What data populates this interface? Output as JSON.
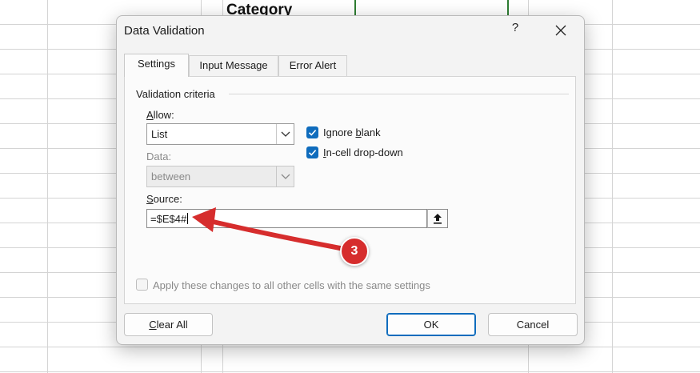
{
  "sheet": {
    "header_cell": "Category"
  },
  "dialog": {
    "title": "Data Validation",
    "help_label": "?",
    "tabs": [
      {
        "label": "Settings",
        "active": true
      },
      {
        "label": "Input Message",
        "active": false
      },
      {
        "label": "Error Alert",
        "active": false
      }
    ],
    "group_title": "Validation criteria",
    "allow": {
      "label_underline": "A",
      "label_rest": "llow:",
      "value": "List"
    },
    "ignore_blank": {
      "label_pre": "Ignore ",
      "label_underline": "b",
      "label_post": "lank",
      "checked": true
    },
    "in_cell_dropdown": {
      "label_underline": "I",
      "label_rest": "n-cell drop-down",
      "checked": true
    },
    "data": {
      "label": "Data:",
      "value": "between",
      "disabled": true
    },
    "source": {
      "label_underline": "S",
      "label_rest": "ource:",
      "value": "=$E$4#"
    },
    "apply_all": {
      "label": "Apply these changes to all other cells with the same settings",
      "checked": false,
      "disabled": true
    },
    "buttons": {
      "clear_all_underline": "C",
      "clear_all_rest": "lear All",
      "ok": "OK",
      "cancel": "Cancel"
    }
  },
  "annotation": {
    "step_number": "3",
    "color": "#d62d2d"
  }
}
